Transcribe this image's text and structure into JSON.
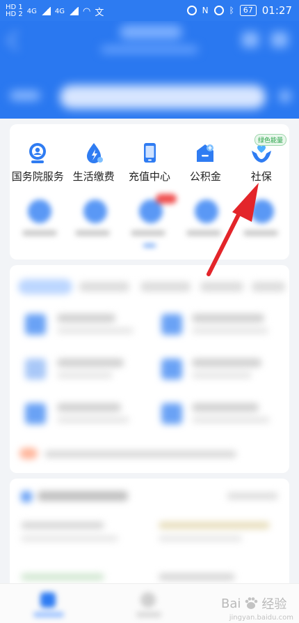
{
  "statusbar": {
    "left_labels": [
      "HD 1",
      "HD 2",
      "4G",
      "4G"
    ],
    "battery": "67",
    "time": "01:27"
  },
  "services": [
    {
      "label": "国务院服务",
      "icon": "gov-service-icon"
    },
    {
      "label": "生活缴费",
      "icon": "utility-bill-icon"
    },
    {
      "label": "充值中心",
      "icon": "phone-recharge-icon"
    },
    {
      "label": "公积金",
      "icon": "housing-fund-icon"
    },
    {
      "label": "社保",
      "icon": "social-security-icon",
      "badge": "绿色能量"
    }
  ],
  "annotation": {
    "color": "#e3252a"
  },
  "watermark": {
    "brand": "Bai",
    "suffix": "经验",
    "sub": "jingyan.baidu.com"
  },
  "colors": {
    "primary": "#2a78f0",
    "accent_green": "#2ba34a"
  }
}
